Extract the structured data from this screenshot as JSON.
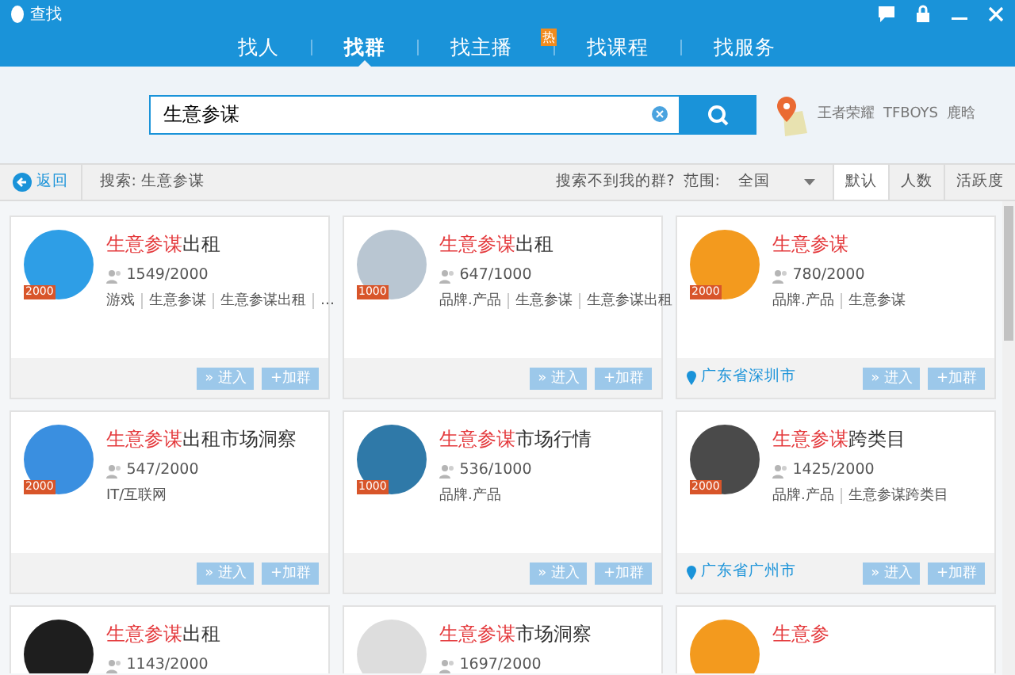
{
  "window": {
    "title": "查找"
  },
  "tabs": [
    {
      "label": "找人",
      "selected": false
    },
    {
      "label": "找群",
      "selected": true
    },
    {
      "label": "找主播",
      "selected": false,
      "badge": "热"
    },
    {
      "label": "找课程",
      "selected": false
    },
    {
      "label": "找服务",
      "selected": false
    }
  ],
  "search": {
    "value": "生意参谋"
  },
  "hot_keywords": [
    "王者荣耀",
    "TFBOYS",
    "鹿晗"
  ],
  "toolbar": {
    "back": "返回",
    "query": "搜索: 生意参谋",
    "not_found": "搜索不到我的群?",
    "scope_label": "范围:",
    "scope": "全国"
  },
  "sort_tabs": [
    {
      "label": "默认",
      "selected": true
    },
    {
      "label": "人数",
      "selected": false
    },
    {
      "label": "活跃度",
      "selected": false
    }
  ],
  "groups": [
    {
      "title_hl": "生意参谋",
      "title_rest": "出租",
      "count": "1549/2000",
      "tags": [
        "游戏",
        "生意参谋",
        "生意参谋出租",
        "…"
      ],
      "avatar_badge": "2000",
      "color": "#2e9ee6",
      "actions": [
        "» 进入",
        "+加群"
      ]
    },
    {
      "title_hl": "生意参谋",
      "title_rest": "出租",
      "count": "647/1000",
      "tags": [
        "品牌.产品",
        "生意参谋",
        "生意参谋出租"
      ],
      "avatar_badge": "1000",
      "color": "#b9c6d2",
      "actions": [
        "» 进入",
        "+加群"
      ]
    },
    {
      "title_hl": "生意参谋",
      "count": "780/2000",
      "tags": [
        "品牌.产品",
        "生意参谋"
      ],
      "location": "广东省深圳市",
      "avatar_badge": "2000",
      "color": "#f39a1e",
      "actions": [
        "» 进入",
        "+加群"
      ]
    },
    {
      "title_hl": "生意参谋",
      "title_rest": "出租市场洞察",
      "count": "547/2000",
      "tags": [
        "IT/互联网"
      ],
      "avatar_badge": "2000",
      "color": "#3a8fe0",
      "actions": [
        "» 进入",
        "+加群"
      ]
    },
    {
      "title_hl": "生意参谋",
      "title_rest": "市场行情",
      "count": "536/1000",
      "tags": [
        "品牌.产品"
      ],
      "avatar_badge": "1000",
      "color": "#2f79a8",
      "actions": [
        "» 进入",
        "+加群"
      ]
    },
    {
      "title_hl": "生意参谋",
      "title_rest": "跨类目",
      "count": "1425/2000",
      "tags": [
        "品牌.产品",
        "生意参谋跨类目"
      ],
      "location": "广东省广州市",
      "avatar_badge": "2000",
      "color": "#4a4a4a",
      "actions": [
        "» 进入",
        "+加群"
      ]
    },
    {
      "title_hl": "生意参谋",
      "title_rest": "出租",
      "count": "1143/2000",
      "color": "#1e1e1e"
    },
    {
      "title_hl": "生意参谋",
      "title_rest": "市场洞察",
      "count": "1697/2000",
      "color": "#dddddd"
    },
    {
      "title_hl": "生意参",
      "color": "#f39a1e"
    }
  ]
}
